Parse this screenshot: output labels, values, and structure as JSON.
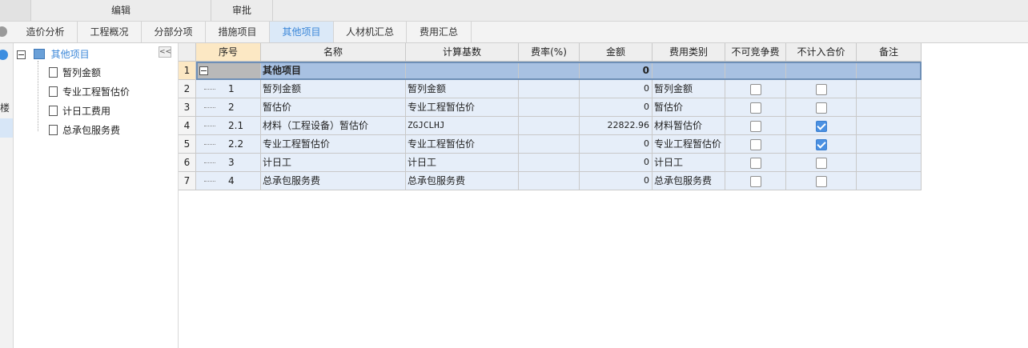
{
  "toolbar": {
    "edit": "编辑",
    "review": "审批"
  },
  "tabs": [
    {
      "label": "造价分析"
    },
    {
      "label": "工程概况"
    },
    {
      "label": "分部分项"
    },
    {
      "label": "措施项目"
    },
    {
      "label": "其他项目"
    },
    {
      "label": "人材机汇总"
    },
    {
      "label": "费用汇总"
    }
  ],
  "active_tab": "其他项目",
  "left_strip": {
    "label": "楼"
  },
  "tree": {
    "root": "其他项目",
    "items": [
      "暂列金额",
      "专业工程暂估价",
      "计日工费用",
      "总承包服务费"
    ],
    "collapse": "<<"
  },
  "table": {
    "headers": [
      "序号",
      "名称",
      "计算基数",
      "费率(%)",
      "金额",
      "费用类别",
      "不可竞争费",
      "不计入合价",
      "备注"
    ],
    "rows": [
      {
        "rn": "1",
        "seq": "",
        "name": "其他项目",
        "base": "",
        "rate": "",
        "amount": "0",
        "category": "",
        "nc": null,
        "ni": null,
        "note": ""
      },
      {
        "rn": "2",
        "seq": "1",
        "name": "暂列金额",
        "base": "暂列金额",
        "rate": "",
        "amount": "0",
        "category": "暂列金额",
        "nc": false,
        "ni": false,
        "note": ""
      },
      {
        "rn": "3",
        "seq": "2",
        "name": "暂估价",
        "base": "专业工程暂估价",
        "rate": "",
        "amount": "0",
        "category": "暂估价",
        "nc": false,
        "ni": false,
        "note": ""
      },
      {
        "rn": "4",
        "seq": "2.1",
        "name": "材料（工程设备）暂估价",
        "base": "ZGJCLHJ",
        "rate": "",
        "amount": "22822.96",
        "category": "材料暂估价",
        "nc": false,
        "ni": true,
        "note": ""
      },
      {
        "rn": "5",
        "seq": "2.2",
        "name": "专业工程暂估价",
        "base": "专业工程暂估价",
        "rate": "",
        "amount": "0",
        "category": "专业工程暂估价",
        "nc": false,
        "ni": true,
        "note": ""
      },
      {
        "rn": "6",
        "seq": "3",
        "name": "计日工",
        "base": "计日工",
        "rate": "",
        "amount": "0",
        "category": "计日工",
        "nc": false,
        "ni": false,
        "note": ""
      },
      {
        "rn": "7",
        "seq": "4",
        "name": "总承包服务费",
        "base": "总承包服务费",
        "rate": "",
        "amount": "0",
        "category": "总承包服务费",
        "nc": false,
        "ni": false,
        "note": ""
      }
    ]
  },
  "colors": {
    "accent": "#3a86d8",
    "selected_row": "#a8c1e2",
    "row_bg": "#e6eef9",
    "header_seq": "#fce8c4"
  }
}
